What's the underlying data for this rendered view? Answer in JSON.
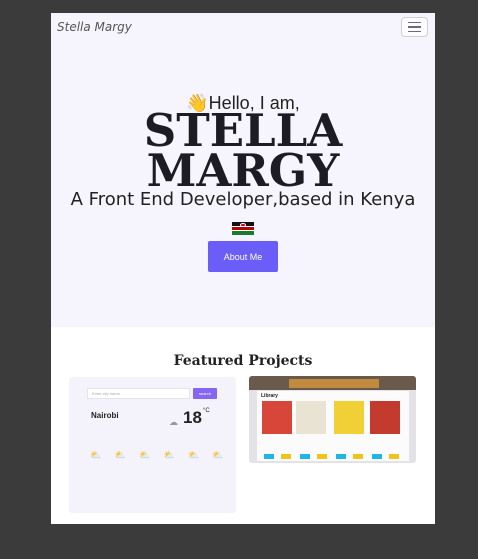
{
  "navbar": {
    "brand": "Stella Margy"
  },
  "hero": {
    "greeting": "👋Hello, I am,",
    "name_line1": "STELLA",
    "name_line2": "MARGY",
    "tagline": "A Front End Developer,based in Kenya",
    "about_button": "About Me"
  },
  "projects": {
    "heading": "Featured Projects",
    "weather": {
      "search_placeholder": "Enter city name",
      "search_button": "search",
      "city": "Nairobi",
      "temperature": "18",
      "unit": "°C"
    },
    "library": {
      "title": "Library"
    }
  },
  "colors": {
    "accent": "#6b5ef8",
    "hero_bg": "#f6f5fd",
    "frame": "#3b3b3b"
  }
}
